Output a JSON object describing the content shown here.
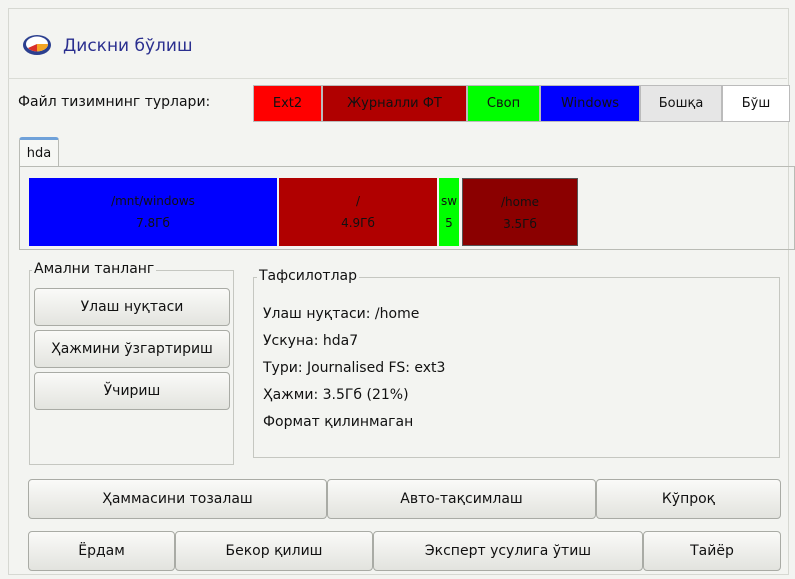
{
  "header": {
    "title": "Дискни бўлиш"
  },
  "fs_types": {
    "label": "Файл тизимнинг турлари:",
    "items": [
      {
        "label": "Ext2",
        "color": "#ff0000",
        "text_color": "#000000"
      },
      {
        "label": "Журналли ФТ",
        "color": "#b00000",
        "text_color": "#000000"
      },
      {
        "label": "Своп",
        "color": "#00ff00",
        "text_color": "#000000"
      },
      {
        "label": "Windows",
        "color": "#0000ff",
        "text_color": "#000000"
      },
      {
        "label": "Бошқа",
        "color": "#e6e6e6",
        "text_color": "#000000"
      },
      {
        "label": "Бўш",
        "color": "#ffffff",
        "text_color": "#000000"
      }
    ]
  },
  "disk_tab": "hda",
  "partitions": [
    {
      "mount": "/mnt/windows",
      "size": "7.8Гб",
      "color": "#0000ff"
    },
    {
      "mount": "/",
      "size": "4.9Гб",
      "color": "#b00000"
    },
    {
      "mount": "sw",
      "size": "5",
      "color": "#00ff00"
    },
    {
      "mount": "/home",
      "size": "3.5Гб",
      "color": "#8b0000"
    }
  ],
  "actions": {
    "title": "Амални танланг",
    "mount_point": "Улаш нуқтаси",
    "resize": "Ҳажмини ўзгартириш",
    "delete": "Ўчириш"
  },
  "details": {
    "title": "Тафсилотлар",
    "mount": "Улаш нуқтаси: /home",
    "device": "Ускуна: hda7",
    "type": "Тури: Journalised FS: ext3",
    "size": "Ҳажми: 3.5Гб (21%)",
    "format": "Формат қилинмаган"
  },
  "buttons": {
    "clear_all": "Ҳаммасини тозалаш",
    "auto_allocate": "Авто-тақсимлаш",
    "more": "Кўпроқ",
    "help": "Ёрдам",
    "cancel": "Бекор қилиш",
    "expert_mode": "Эксперт усулига ўтиш",
    "done": "Тайёр"
  }
}
